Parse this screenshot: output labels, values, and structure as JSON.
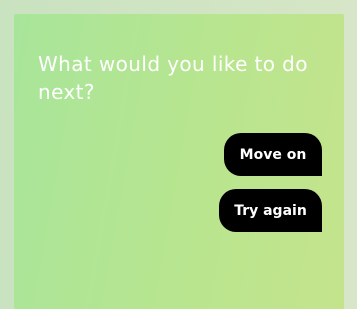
{
  "prompt": {
    "question": "What would you like to do next?"
  },
  "actions": {
    "move_on_label": "Move on",
    "try_again_label": "Try again"
  },
  "colors": {
    "background": "#c9e3c2",
    "card_gradient_start": "#a8e59a",
    "card_gradient_end": "#c4e48c",
    "button": "#000000",
    "text": "#ffffff"
  }
}
